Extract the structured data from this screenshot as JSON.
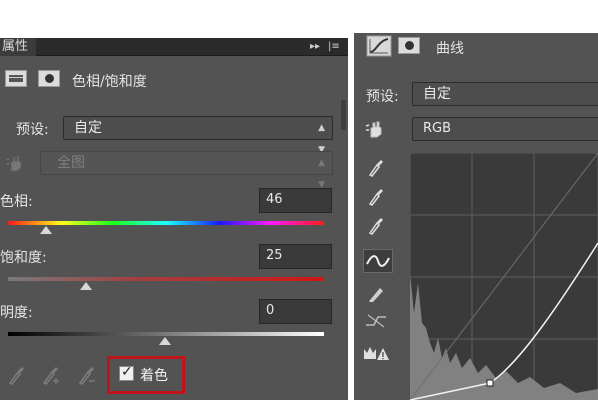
{
  "left_panel": {
    "tab_title": "属性",
    "collapse_glyph": "▸▸",
    "menu_glyph": "|≡",
    "adjustment_title": "色相/饱和度",
    "preset_label": "预设:",
    "preset_value": "自定",
    "range_value": "全图",
    "hue_label": "色相:",
    "hue_value": "46",
    "saturation_label": "饱和度:",
    "saturation_value": "25",
    "lightness_label": "明度:",
    "lightness_value": "0",
    "colorize_label": "着色",
    "colorize_checked": true,
    "highlight_color": "#c0141a"
  },
  "right_panel": {
    "adjustment_title": "曲线",
    "preset_label": "预设:",
    "preset_value": "自定",
    "channel_value": "RGB"
  },
  "icons": [
    "hue-saturation-icon",
    "mask-icon",
    "hand-target-icon",
    "eyedropper-icon",
    "eyedropper-plus-icon",
    "eyedropper-minus-icon",
    "curves-icon",
    "pencil-icon",
    "smooth-icon",
    "clipping-warning-icon",
    "checkbox-icon"
  ]
}
